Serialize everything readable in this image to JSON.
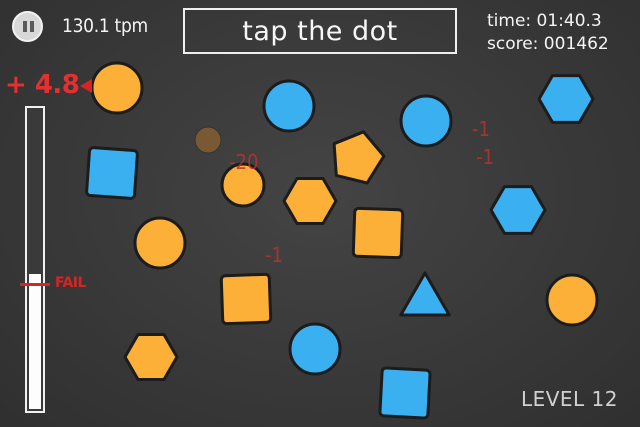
{
  "hud": {
    "pause_icon": "pause-icon",
    "tempo": "130.1 tpm",
    "instruction": "tap the dot",
    "time": "time: 01:40.3",
    "score": "score: 001462",
    "bonus": "+ 4.8",
    "fail_label": "FAIL",
    "level": "LEVEL 12",
    "meter_fill": 0.45
  },
  "colors": {
    "orange": "#fdb037",
    "blue": "#3ab0f1",
    "outline": "#1c1c1c",
    "red": "#d52424",
    "faded_orange": "#a8702d"
  },
  "floating_scores": [
    {
      "text": "-20"
    },
    {
      "text": "-1"
    },
    {
      "text": "-1"
    },
    {
      "text": "-1"
    }
  ],
  "shapes": [
    {
      "kind": "circle",
      "color": "orange",
      "name": "orange-circle-top-left"
    },
    {
      "kind": "circle",
      "color": "blue",
      "name": "blue-circle-top"
    },
    {
      "kind": "circle",
      "color": "blue",
      "name": "blue-circle-top-right"
    },
    {
      "kind": "hexagon",
      "color": "blue",
      "name": "blue-hexagon-top-right"
    },
    {
      "kind": "square",
      "color": "blue",
      "name": "blue-square-left"
    },
    {
      "kind": "pentagon",
      "color": "orange",
      "name": "orange-pentagon"
    },
    {
      "kind": "circle",
      "color": "faded",
      "name": "faded-circle"
    },
    {
      "kind": "circle",
      "color": "orange",
      "name": "orange-circle-center-left"
    },
    {
      "kind": "hexagon",
      "color": "orange",
      "name": "orange-hexagon-center"
    },
    {
      "kind": "square",
      "color": "orange",
      "name": "orange-square-center"
    },
    {
      "kind": "hexagon",
      "color": "blue",
      "name": "blue-hexagon-right"
    },
    {
      "kind": "circle",
      "color": "orange",
      "name": "orange-circle-left"
    },
    {
      "kind": "square",
      "color": "orange",
      "name": "orange-square-lower"
    },
    {
      "kind": "triangle",
      "color": "blue",
      "name": "blue-triangle"
    },
    {
      "kind": "circle",
      "color": "orange",
      "name": "orange-circle-right"
    },
    {
      "kind": "hexagon",
      "color": "orange",
      "name": "orange-hexagon-bottom-left"
    },
    {
      "kind": "circle",
      "color": "blue",
      "name": "blue-circle-bottom"
    },
    {
      "kind": "square",
      "color": "blue",
      "name": "blue-square-bottom"
    }
  ]
}
